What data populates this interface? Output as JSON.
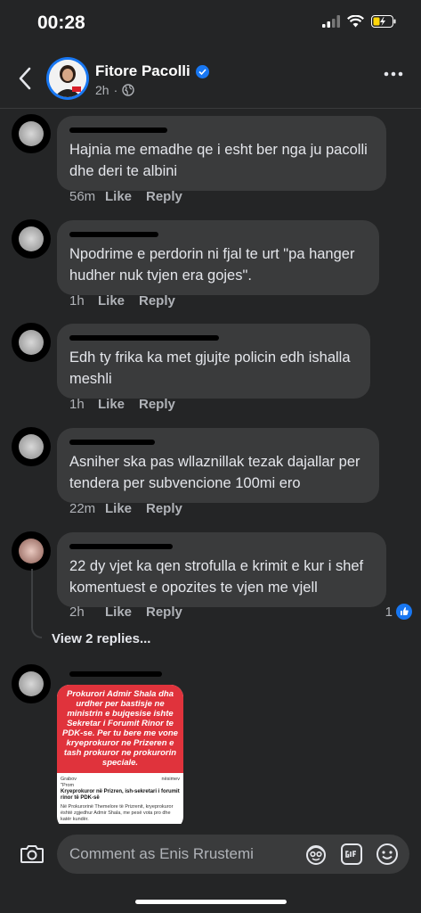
{
  "status": {
    "time": "00:28"
  },
  "header": {
    "name": "Fitore Pacolli",
    "time_ago": "2h"
  },
  "comments": [
    {
      "text": "Hajnia me emadhe qe i esht ber nga ju pacolli\ndhe deri te albini",
      "time": "56m",
      "like": "Like",
      "reply": "Reply"
    },
    {
      "text": "Npodrime e perdorin ni fjal te urt \"pa hanger\nhudher nuk tvjen era gojes\".",
      "time": "1h",
      "like": "Like",
      "reply": "Reply"
    },
    {
      "text": "Edh ty frika ka met gjujte policin edh ishalla\nmeshli",
      "time": "1h",
      "like": "Like",
      "reply": "Reply"
    },
    {
      "text": "Asniher ska pas wllaznillak tezak dajallar per\ntendera per subvencione 100mi ero",
      "time": "22m",
      "like": "Like",
      "reply": "Reply"
    },
    {
      "text": "22 dy vjet ka qen strofulla e krimit e kur i shef\nkomentuest e opozites te vjen me vjell",
      "time": "2h",
      "like": "Like",
      "reply": "Reply",
      "reactions": "1"
    }
  ],
  "view_replies": "View 2 replies...",
  "image_post": {
    "headline": "Prokurori Admir Shala dha urdher per bastisje ne ministrin e bujqesise ishte Sekretar i Forumit Rinor te PDK-se. Per tu bere me vone kryeprokuror ne Prizeren e tash prokuror ne prokurorin speciale.",
    "caption": "Kryeprokuror në Prizren, ish-sekretari i forumit rinor të PDK-së",
    "body": "Në Prokurorinë Themelore të Prizrenit, kryeprokuror është zgjedhur Admir Shala, me pesë vota pro dhe katër kundër.",
    "fragment_left": "Grabov",
    "fragment_prom": "\"Prom",
    "fragment_right": "nësimev"
  },
  "composer": {
    "placeholder": "Comment as Enis Rrustemi"
  }
}
